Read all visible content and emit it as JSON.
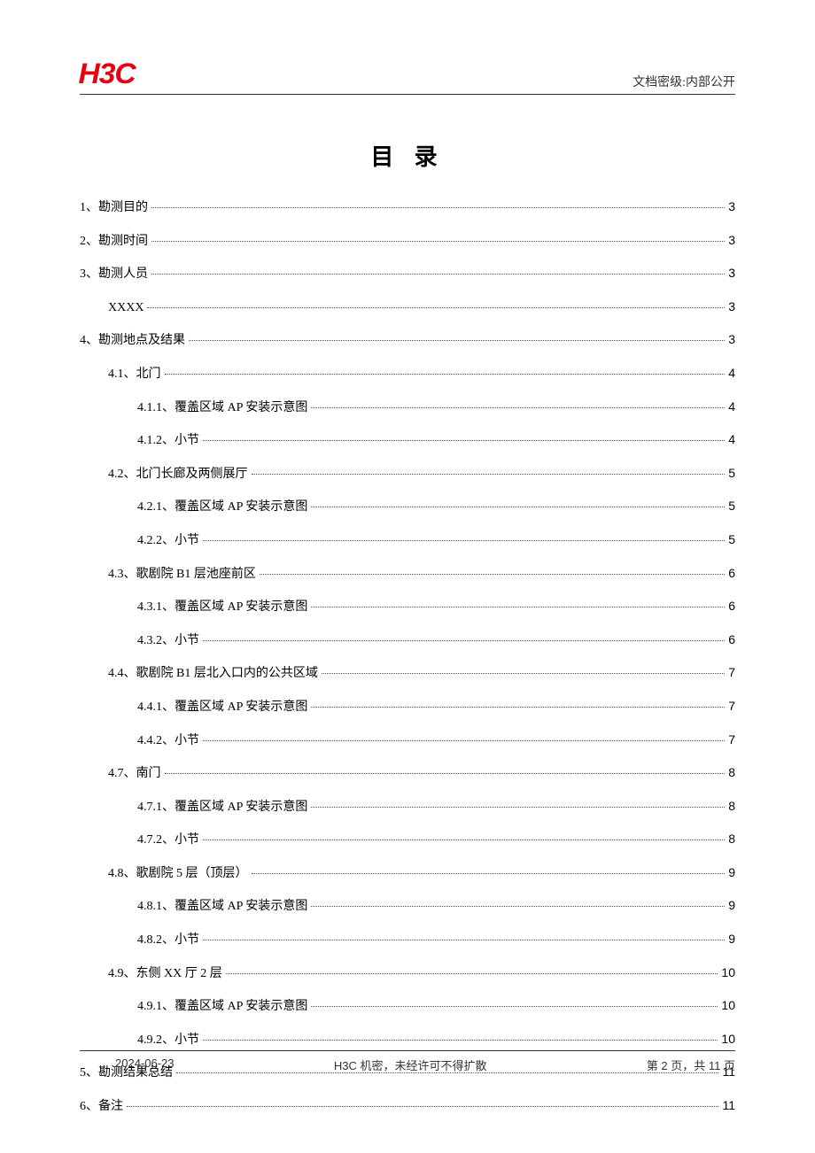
{
  "header": {
    "logo_text": "H3C",
    "classification": "文档密级:内部公开"
  },
  "title": "目 录",
  "toc": [
    {
      "level": 1,
      "label": "1、勘测目的",
      "page": "3"
    },
    {
      "level": 1,
      "label": "2、勘测时间",
      "page": "3"
    },
    {
      "level": 1,
      "label": "3、勘测人员",
      "page": "3"
    },
    {
      "level": 2,
      "label": "XXXX",
      "page": "3"
    },
    {
      "level": 1,
      "label": "4、勘测地点及结果",
      "page": "3"
    },
    {
      "level": 2,
      "label": "4.1、北门",
      "page": "4"
    },
    {
      "level": 3,
      "label": "4.1.1、覆盖区域 AP 安装示意图",
      "page": "4"
    },
    {
      "level": 3,
      "label": "4.1.2、小节",
      "page": "4"
    },
    {
      "level": 2,
      "label": "4.2、北门长廊及两侧展厅",
      "page": "5"
    },
    {
      "level": 3,
      "label": "4.2.1、覆盖区域 AP 安装示意图",
      "page": "5"
    },
    {
      "level": 3,
      "label": "4.2.2、小节",
      "page": "5"
    },
    {
      "level": 2,
      "label": "4.3、歌剧院 B1 层池座前区",
      "page": "6"
    },
    {
      "level": 3,
      "label": "4.3.1、覆盖区域 AP 安装示意图",
      "page": "6"
    },
    {
      "level": 3,
      "label": "4.3.2、小节",
      "page": "6"
    },
    {
      "level": 2,
      "label": "4.4、歌剧院 B1 层北入口内的公共区域",
      "page": "7"
    },
    {
      "level": 3,
      "label": "4.4.1、覆盖区域 AP 安装示意图",
      "page": "7"
    },
    {
      "level": 3,
      "label": "4.4.2、小节",
      "page": "7"
    },
    {
      "level": 2,
      "label": "4.7、南门",
      "page": "8"
    },
    {
      "level": 3,
      "label": "4.7.1、覆盖区域 AP 安装示意图",
      "page": "8"
    },
    {
      "level": 3,
      "label": "4.7.2、小节",
      "page": "8"
    },
    {
      "level": 2,
      "label": "4.8、歌剧院 5 层（顶层）",
      "page": "9"
    },
    {
      "level": 3,
      "label": "4.8.1、覆盖区域 AP 安装示意图",
      "page": "9"
    },
    {
      "level": 3,
      "label": "4.8.2、小节",
      "page": "9"
    },
    {
      "level": 2,
      "label": "4.9、东侧 XX 厅 2 层",
      "page": "10"
    },
    {
      "level": 3,
      "label": "4.9.1、覆盖区域 AP 安装示意图",
      "page": "10"
    },
    {
      "level": 3,
      "label": "4.9.2、小节",
      "page": "10"
    },
    {
      "level": 1,
      "label": "5、勘测结果总结",
      "page": "11"
    },
    {
      "level": 1,
      "label": "6、备注",
      "page": "11"
    }
  ],
  "footer": {
    "date": "2024-06-23",
    "confidential": "H3C 机密，未经许可不得扩散",
    "page_info": "第 2 页，共 11 页"
  }
}
